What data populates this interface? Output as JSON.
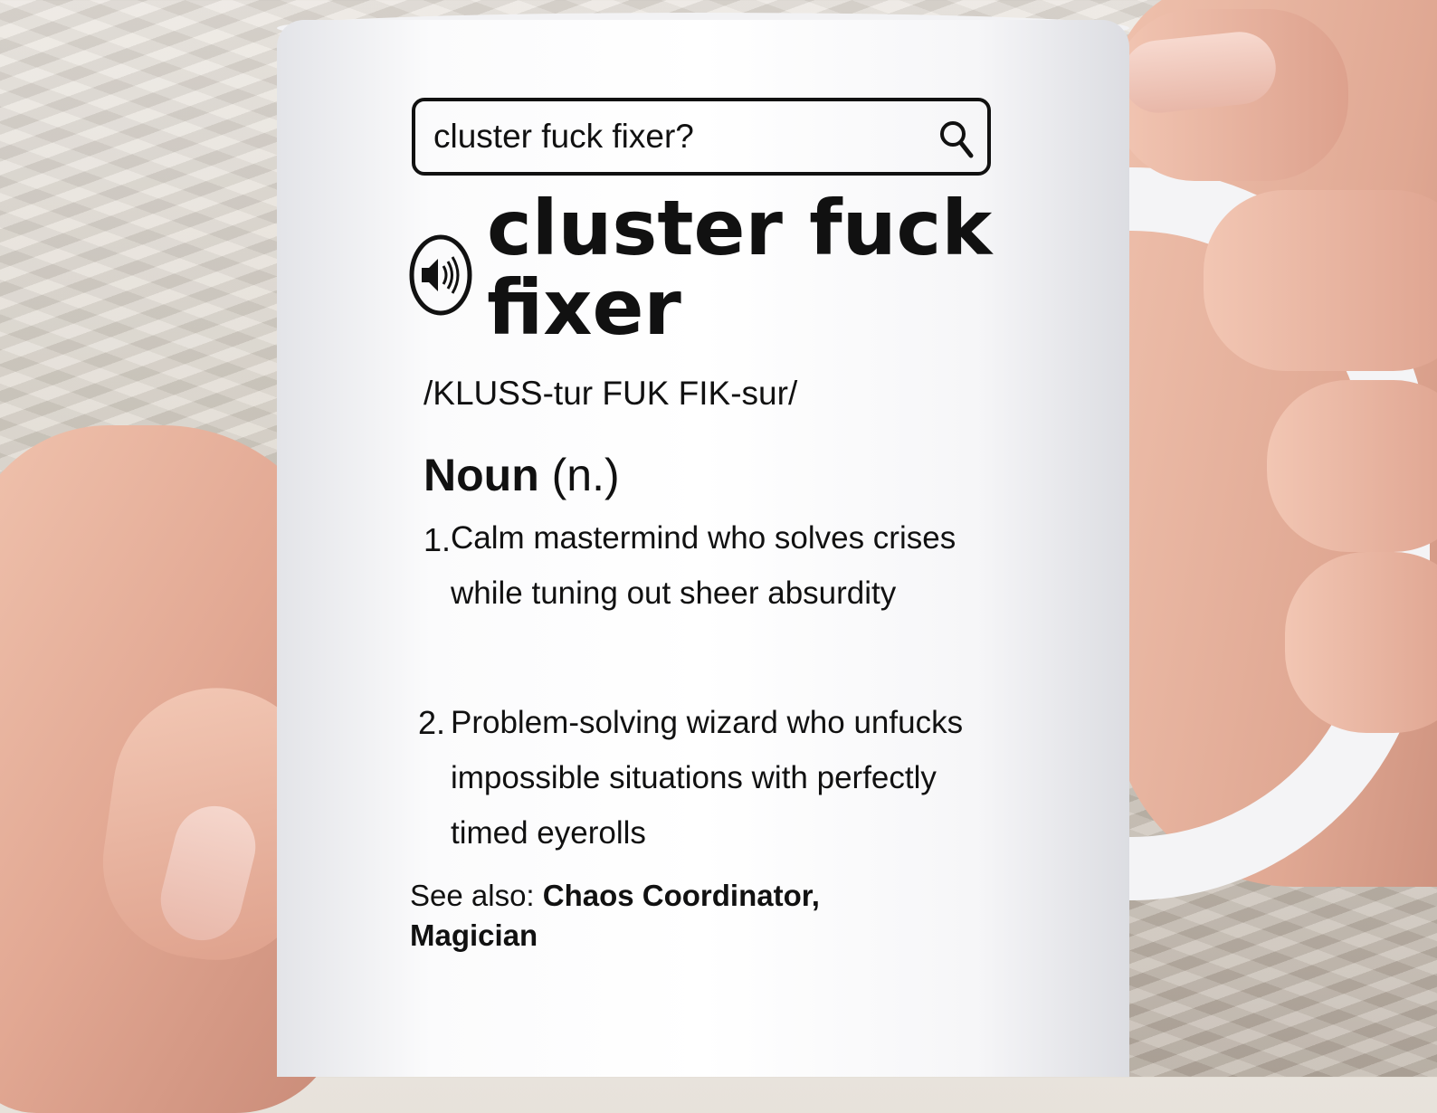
{
  "search": {
    "query": "cluster fuck fixer?"
  },
  "entry": {
    "term": "cluster fuck fixer",
    "pronunciation": "/KLUSS-tur FUK FIK-sur/",
    "part_of_speech": "Noun",
    "abbrev": "(n.)",
    "definitions": [
      {
        "number": "1.",
        "text": "Calm mastermind who solves crises while tuning out sheer absurdity"
      },
      {
        "number": "2.",
        "text": "Problem-solving wizard who unfucks impossible situations with perfectly timed eyerolls"
      }
    ],
    "see_also_label": "See also:",
    "see_also_refs": "Chaos Coordinator, Magician"
  },
  "icons": {
    "search": "search-icon",
    "speaker": "speaker-icon"
  },
  "colors": {
    "ink": "#111111",
    "mug": "#ffffff"
  }
}
